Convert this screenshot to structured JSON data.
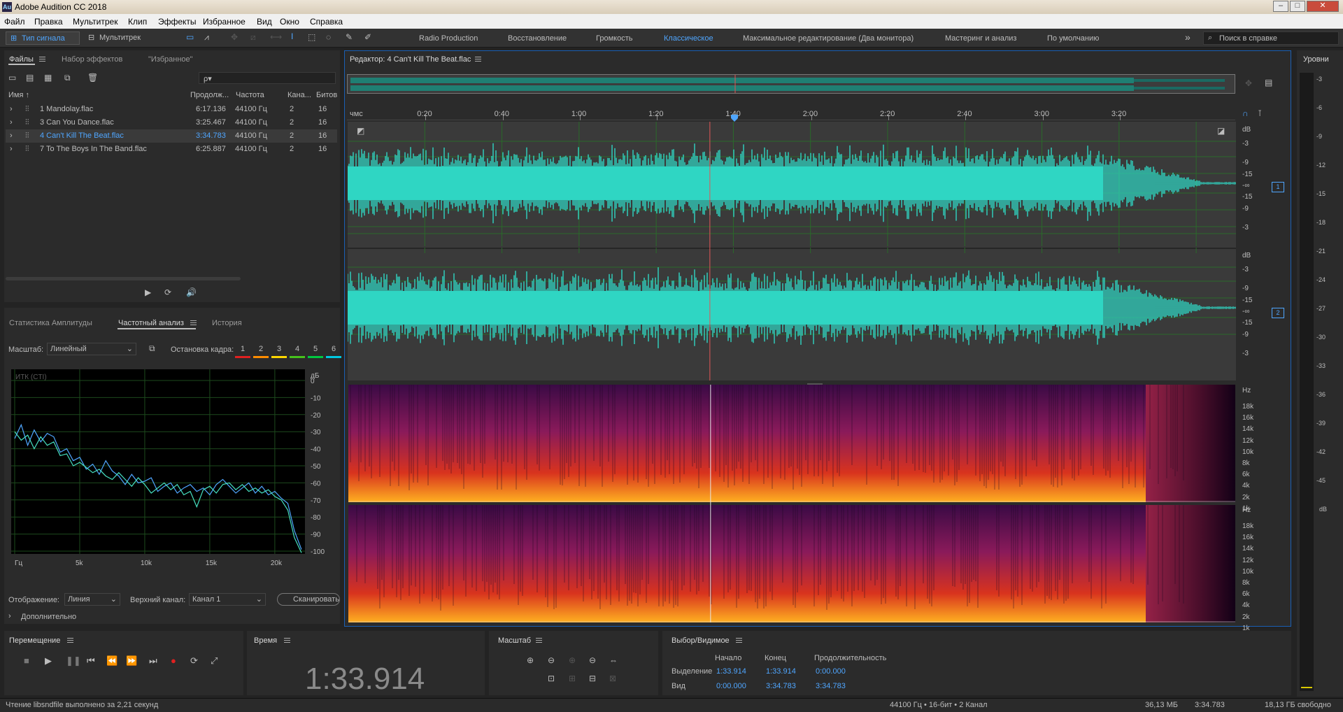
{
  "window": {
    "title": "Adobe Audition CC 2018",
    "app_icon": "Au"
  },
  "menu": [
    "Файл",
    "Правка",
    "Мультитрек",
    "Клип",
    "Эффекты",
    "Избранное",
    "Вид",
    "Окно",
    "Справка"
  ],
  "toolbar": {
    "waveform_label": "Тип сигнала",
    "multitrack_label": "Мультитрек",
    "workspaces": [
      "Radio Production",
      "Восстановление",
      "Громкость",
      "Классическое",
      "Максимальное редактирование (Два монитора)",
      "Мастеринг и анализ",
      "По умолчанию"
    ],
    "active_workspace": "Классическое",
    "help_search_placeholder": "Поиск в справке"
  },
  "files_panel": {
    "tabs": [
      "Файлы",
      "Набор эффектов",
      "\"Избранное\""
    ],
    "search_placeholder": "ρ▾",
    "columns": [
      "Имя ↑",
      "Продолж...",
      "Частота",
      "Кана...",
      "Битов"
    ],
    "files": [
      {
        "name": "1 Mandolay.flac",
        "duration": "6:17.136",
        "rate": "44100 Гц",
        "channels": "2",
        "bits": "16"
      },
      {
        "name": "3 Can You Dance.flac",
        "duration": "3:25.467",
        "rate": "44100 Гц",
        "channels": "2",
        "bits": "16"
      },
      {
        "name": "4 Can't Kill The Beat.flac",
        "duration": "3:34.783",
        "rate": "44100 Гц",
        "channels": "2",
        "bits": "16"
      },
      {
        "name": "7 To The Boys In The Band.flac",
        "duration": "6:25.887",
        "rate": "44100 Гц",
        "channels": "2",
        "bits": "16"
      }
    ],
    "selected_index": 2
  },
  "analysis_panel": {
    "tabs": [
      "Статистика Амплитуды",
      "Частотный анализ",
      "История"
    ],
    "scale_label": "Масштаб:",
    "scale_value": "Линейный",
    "freeze_label": "Остановка кадра:",
    "freeze_slots": [
      {
        "n": "1",
        "color": "#e02020"
      },
      {
        "n": "2",
        "color": "#ff8c00"
      },
      {
        "n": "3",
        "color": "#ffd700"
      },
      {
        "n": "4",
        "color": "#46c21c"
      },
      {
        "n": "5",
        "color": "#00c840"
      },
      {
        "n": "6",
        "color": "#00c8e0"
      }
    ],
    "cti_label": "ИТК (CTI)",
    "db_unit": "дБ",
    "db_ticks": [
      "0",
      "-10",
      "-20",
      "-30",
      "-40",
      "-50",
      "-60",
      "-70",
      "-80",
      "-90",
      "-100"
    ],
    "freq_ticks": [
      "Гц",
      "5k",
      "10k",
      "15k",
      "20k"
    ],
    "display_label": "Отображение:",
    "display_value": "Линия",
    "channel_label": "Верхний канал:",
    "channel_value": "Канал 1",
    "scan_button": "Сканировать",
    "advanced_label": "Дополнительно"
  },
  "chart_data": {
    "type": "line",
    "xlabel": "Гц",
    "ylabel": "дБ",
    "xlim": [
      0,
      22050
    ],
    "ylim": [
      -100,
      0
    ],
    "series": [
      {
        "color": "#4fa6ff",
        "values": [
          [
            0,
            -34
          ],
          [
            500,
            -26
          ],
          [
            1000,
            -38
          ],
          [
            1500,
            -29
          ],
          [
            2000,
            -36
          ],
          [
            2500,
            -31
          ],
          [
            3000,
            -33
          ],
          [
            3500,
            -42
          ],
          [
            4000,
            -40
          ],
          [
            4500,
            -47
          ],
          [
            5000,
            -45
          ],
          [
            5500,
            -52
          ],
          [
            6000,
            -49
          ],
          [
            6500,
            -55
          ],
          [
            7000,
            -47
          ],
          [
            7500,
            -53
          ],
          [
            8000,
            -56
          ],
          [
            8500,
            -61
          ],
          [
            9000,
            -55
          ],
          [
            9500,
            -60
          ],
          [
            10000,
            -59
          ],
          [
            10500,
            -57
          ],
          [
            11000,
            -65
          ],
          [
            11500,
            -62
          ],
          [
            12000,
            -60
          ],
          [
            12500,
            -66
          ],
          [
            13000,
            -63
          ],
          [
            13500,
            -61
          ],
          [
            14000,
            -65
          ],
          [
            14500,
            -63
          ],
          [
            15000,
            -67
          ],
          [
            15500,
            -61
          ],
          [
            16000,
            -58
          ],
          [
            16500,
            -62
          ],
          [
            17000,
            -66
          ],
          [
            17500,
            -63
          ],
          [
            18000,
            -60
          ],
          [
            18500,
            -66
          ],
          [
            19000,
            -62
          ],
          [
            19500,
            -67
          ],
          [
            20000,
            -65
          ],
          [
            20500,
            -69
          ],
          [
            21000,
            -72
          ],
          [
            21500,
            -88
          ],
          [
            22050,
            -99
          ]
        ]
      },
      {
        "color": "#46e0c0",
        "values": [
          [
            0,
            -30
          ],
          [
            500,
            -35
          ],
          [
            1000,
            -32
          ],
          [
            1500,
            -40
          ],
          [
            2000,
            -33
          ],
          [
            2500,
            -38
          ],
          [
            3000,
            -36
          ],
          [
            3500,
            -44
          ],
          [
            4000,
            -43
          ],
          [
            4500,
            -50
          ],
          [
            5000,
            -48
          ],
          [
            5500,
            -51
          ],
          [
            6000,
            -54
          ],
          [
            6500,
            -52
          ],
          [
            7000,
            -56
          ],
          [
            7500,
            -58
          ],
          [
            8000,
            -54
          ],
          [
            8500,
            -58
          ],
          [
            9000,
            -62
          ],
          [
            9500,
            -57
          ],
          [
            10000,
            -61
          ],
          [
            10500,
            -66
          ],
          [
            11000,
            -63
          ],
          [
            11500,
            -60
          ],
          [
            12000,
            -64
          ],
          [
            12500,
            -61
          ],
          [
            13000,
            -67
          ],
          [
            13500,
            -65
          ],
          [
            14000,
            -74
          ],
          [
            14500,
            -64
          ],
          [
            15000,
            -62
          ],
          [
            15500,
            -66
          ],
          [
            16000,
            -61
          ],
          [
            16500,
            -60
          ],
          [
            17000,
            -64
          ],
          [
            17500,
            -61
          ],
          [
            18000,
            -65
          ],
          [
            18500,
            -63
          ],
          [
            19000,
            -66
          ],
          [
            19500,
            -64
          ],
          [
            20000,
            -68
          ],
          [
            20500,
            -70
          ],
          [
            21000,
            -76
          ],
          [
            21500,
            -92
          ],
          [
            22050,
            -101
          ]
        ]
      }
    ]
  },
  "editor": {
    "title": "Редактор: 4 Can't Kill The Beat.flac",
    "ruler_unit": "чмс",
    "ruler_ticks": [
      "0:20",
      "0:40",
      "1:00",
      "1:20",
      "1:40",
      "2:00",
      "2:20",
      "2:40",
      "3:00",
      "3:20"
    ],
    "duration_seconds": 214.783,
    "playhead_seconds": 93.914,
    "db_unit": "dB",
    "db_ticks": [
      "-3",
      "-9",
      "-15",
      "-∞",
      "-15",
      "-9",
      "-3"
    ],
    "hz_unit": "Hz",
    "hz_ticks": [
      "18k",
      "16k",
      "14k",
      "12k",
      "10k",
      "8k",
      "6k",
      "4k",
      "2k",
      "1k"
    ],
    "channel_badges": [
      "1",
      "2"
    ],
    "waveform_color": "#2fd6c3"
  },
  "levels_panel": {
    "title": "Уровни",
    "ticks": [
      "-3",
      "-6",
      "-9",
      "-12",
      "-15",
      "-18",
      "-21",
      "-24",
      "-27",
      "-30",
      "-33",
      "-36",
      "-39",
      "-42",
      "-45",
      "dB"
    ]
  },
  "transport": {
    "title": "Перемещение"
  },
  "time_panel": {
    "title": "Время",
    "value": "1:33.914"
  },
  "zoom_panel": {
    "title": "Масштаб"
  },
  "selection_panel": {
    "title": "Выбор/Видимое",
    "headers": [
      "Начало",
      "Конец",
      "Продолжительность"
    ],
    "rows": [
      {
        "label": "Выделение",
        "start": "1:33.914",
        "end": "1:33.914",
        "duration": "0:00.000"
      },
      {
        "label": "Вид",
        "start": "0:00.000",
        "end": "3:34.783",
        "duration": "3:34.783"
      }
    ]
  },
  "status": {
    "message": "Чтение libsndfile выполнено за 2,21 секунд",
    "format": "44100 Гц • 16-бит • 2 Канал",
    "size": "36,13 МБ",
    "duration": "3:34.783",
    "free": "18,13 ГБ свободно"
  }
}
